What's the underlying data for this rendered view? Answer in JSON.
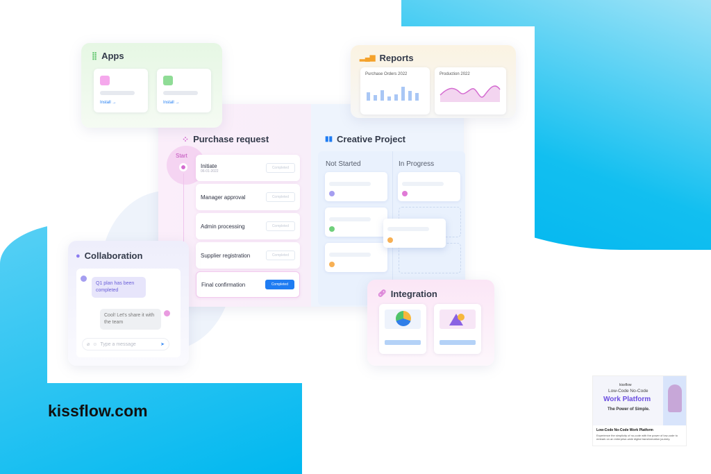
{
  "apps": {
    "title": "Apps",
    "items": [
      {
        "label": "Install",
        "icon": "circle-icon",
        "color": "#f5a8ec"
      },
      {
        "label": "Install",
        "icon": "triangle-icon",
        "color": "#8fdc96"
      }
    ]
  },
  "reports": {
    "title": "Reports",
    "charts": [
      {
        "title": "Purchase Orders 2022",
        "type": "bar"
      },
      {
        "title": "Production 2022",
        "type": "area"
      }
    ]
  },
  "purchase": {
    "title": "Purchase request",
    "start": "Start",
    "steps": [
      {
        "name": "Initiate",
        "date": "06-01-2022",
        "status": "Completed"
      },
      {
        "name": "Manager approval",
        "status": "Completed"
      },
      {
        "name": "Admin processing",
        "status": "Completed"
      },
      {
        "name": "Supplier registration",
        "status": "Completed"
      },
      {
        "name": "Final confirmation",
        "status": "Completed"
      }
    ]
  },
  "creative": {
    "title": "Creative Project",
    "columns": [
      "Not Started",
      "In Progress"
    ]
  },
  "collab": {
    "title": "Collaboration",
    "msg1": "Q1 plan has been completed",
    "msg2": "Cool! Let's share it with the team",
    "placeholder": "Type a message"
  },
  "integration": {
    "title": "Integration"
  },
  "site": "kissflow.com",
  "thumb": {
    "brand": "kissflow",
    "line1": "Low-Code No-Code",
    "line2": "Work Platform",
    "line3": "The Power of Simple.",
    "title": "Low-Code No-Code Work Platform",
    "desc": "Experience the simplicity of no-code with the power of low-code to embark on an enterprise-wide digital transformation journey."
  },
  "colors": {
    "cyan": "#00b8f0",
    "blue": "#1f7cf2",
    "pink": "#d46bd0"
  }
}
